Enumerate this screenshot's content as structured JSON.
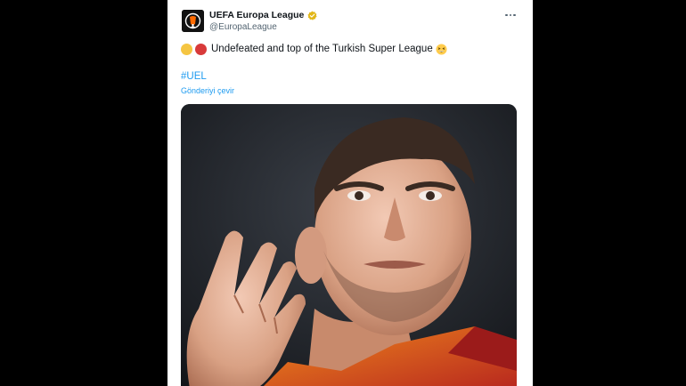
{
  "tweet": {
    "author": {
      "display_name": "UEFA Europa League",
      "handle": "@EuropaLeague",
      "verified": true,
      "avatar_icon": "uefa-europa-league-logo",
      "verified_icon": "verified-badge-icon"
    },
    "menu_icon": "more-options-icon",
    "text": {
      "emoji_prefix": [
        "yellow-circle-emoji",
        "red-circle-emoji"
      ],
      "body": "Undefeated and top of the Turkish Super League",
      "emoji_suffix": "excited-face-emoji"
    },
    "hashtag": "#UEL",
    "translate_label": "Gönderiyi çevir",
    "media": {
      "kind": "photo",
      "description_icon": "player-celebration-photo"
    }
  },
  "colors": {
    "page_background": "#000000",
    "card_background": "#ffffff",
    "text_primary": "#0f1419",
    "text_secondary": "#536471",
    "link": "#1d9bf0",
    "verified_badge": "#e2b719",
    "emoji_yellow": "#f5c542",
    "emoji_red": "#d83a3a"
  }
}
